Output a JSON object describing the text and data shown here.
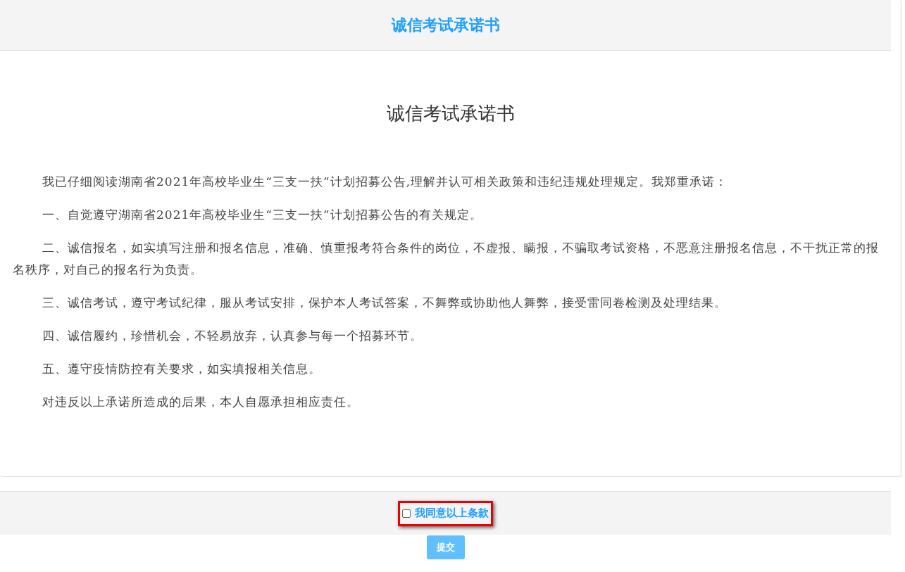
{
  "header": {
    "title": "诚信考试承诺书"
  },
  "document": {
    "title": "诚信考试承诺书",
    "paragraphs": [
      "我已仔细阅读湖南省2021年高校毕业生“三支一扶”计划招募公告,理解并认可相关政策和违纪违规处理规定。我郑重承诺：",
      "一、自觉遵守湖南省2021年高校毕业生“三支一扶”计划招募公告的有关规定。",
      "二、诚信报名，如实填写注册和报名信息，准确、慎重报考符合条件的岗位，不虚报、瞒报，不骗取考试资格，不恶意注册报名信息，不干扰正常的报名秩序，对自己的报名行为负责。",
      "三、诚信考试，遵守考试纪律，服从考试安排，保护本人考试答案，不舞弊或协助他人舞弊，接受雷同卷检测及处理结果。",
      "四、诚信履约，珍惜机会，不轻易放弃，认真参与每一个招募环节。",
      "五、遵守疫情防控有关要求，如实填报相关信息。",
      "对违反以上承诺所造成的后果，本人自愿承担相应责任。"
    ]
  },
  "agreement": {
    "label": "我同意以上条款",
    "checked": false
  },
  "submit_button": {
    "label": "提交"
  }
}
